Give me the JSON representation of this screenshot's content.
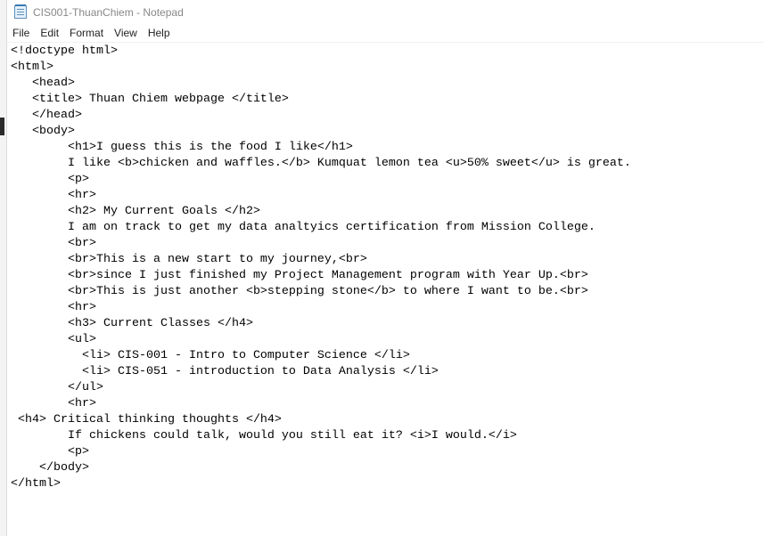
{
  "window": {
    "title": "CIS001-ThuanChiem - Notepad"
  },
  "menu": [
    {
      "label": "File"
    },
    {
      "label": "Edit"
    },
    {
      "label": "Format"
    },
    {
      "label": "View"
    },
    {
      "label": "Help"
    }
  ],
  "editor": {
    "lines": [
      "<!doctype html>",
      "<html>",
      "   <head>",
      "   <title> Thuan Chiem webpage </title>",
      "   </head>",
      "   <body>",
      "        <h1>I guess this is the food I like</h1>",
      "        I like <b>chicken and waffles.</b> Kumquat lemon tea <u>50% sweet</u> is great.",
      "        <p>",
      "        <hr>",
      "        <h2> My Current Goals </h2>",
      "        I am on track to get my data analtyics certification from Mission College.",
      "        <br>",
      "        <br>This is a new start to my journey,<br>",
      "        <br>since I just finished my Project Management program with Year Up.<br>",
      "        <br>This is just another <b>stepping stone</b> to where I want to be.<br>",
      "        <hr>",
      "        <h3> Current Classes </h4>",
      "        <ul>",
      "          <li> CIS-001 - Intro to Computer Science </li>",
      "          <li> CIS-051 - introduction to Data Analysis </li>",
      "        </ul>",
      "        <hr>",
      " <h4> Critical thinking thoughts </h4>",
      "        If chickens could talk, would you still eat it? <i>I would.</i>",
      "        <p>",
      "    </body>",
      "</html>"
    ]
  }
}
